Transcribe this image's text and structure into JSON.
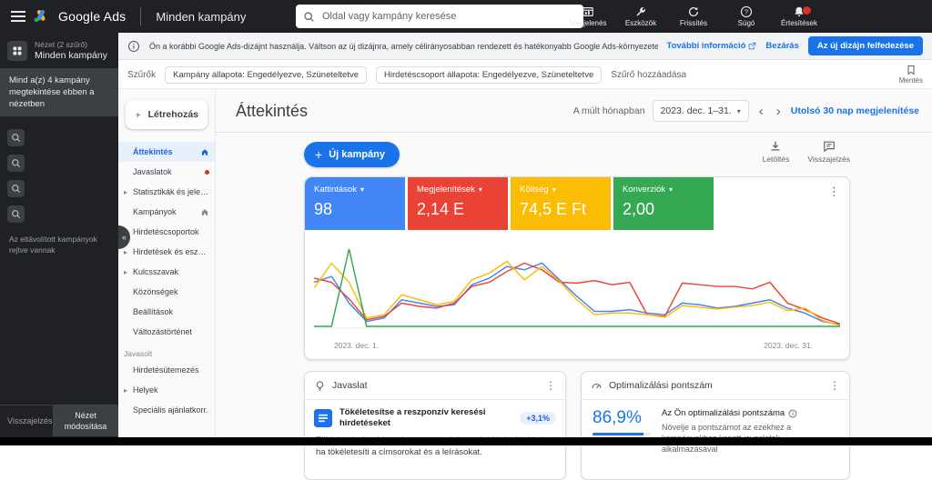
{
  "topbar": {
    "brand": "Google Ads",
    "page_title": "Minden kampány",
    "search_placeholder": "Oldal vagy kampány keresése",
    "actions": [
      {
        "label": "Megjelenés",
        "icon": "appearance-icon"
      },
      {
        "label": "Eszközök",
        "icon": "tools-icon"
      },
      {
        "label": "Frissítés",
        "icon": "refresh-icon"
      },
      {
        "label": "Súgó",
        "icon": "help-icon"
      },
      {
        "label": "Értesítések",
        "icon": "notifications-icon",
        "has_badge": true
      }
    ]
  },
  "sidebar": {
    "view_label": "Nézet (2 szűrő)",
    "view_name": "Minden kampány",
    "selected_note": "Mind a(z) 4 kampány megtekintése ebben a nézetben",
    "hidden_note": "Az eltávolított kampányok rejtve vannak",
    "feedback": "Visszajelzés",
    "modify_view": "Nézet módosítása"
  },
  "banner": {
    "text": "Ön a korábbi Google Ads-dizájnt használja. Váltson az új dizájnra, amely célirányosabban rendezett és hatékonyabb Google Ads-környezetet biztosít.",
    "learn_more": "További információ",
    "dismiss": "Bezárás",
    "cta": "Az új dizájn felfedezése"
  },
  "filters": {
    "label": "Szűrők",
    "chips": [
      "Kampány állapota: Engedélyezve, Szüneteltetve",
      "Hirdetéscsoport állapota: Engedélyezve, Szüneteltetve"
    ],
    "add": "Szűrő hozzáadása",
    "save": "Mentés"
  },
  "nav": {
    "create": "Létrehozás",
    "items": [
      {
        "label": "Áttekintés",
        "selected": true,
        "home": true
      },
      {
        "label": "Javaslatok",
        "dot": true
      },
      {
        "label": "Statisztikák és jelentések",
        "expandable": true
      },
      {
        "label": "Kampányok",
        "home": true
      },
      {
        "label": "Hirdetéscsoportok"
      },
      {
        "label": "Hirdetések és eszközök",
        "expandable": true
      },
      {
        "label": "Kulcsszavak",
        "expandable": true
      },
      {
        "label": "Közönségek"
      },
      {
        "label": "Beállítások"
      },
      {
        "label": "Változástörténet"
      },
      {
        "label": "Javasolt",
        "section": true
      },
      {
        "label": "Hirdetésütemezés"
      },
      {
        "label": "Helyek",
        "expandable": true
      },
      {
        "label": "Speciális ajánlatkorr."
      }
    ]
  },
  "main": {
    "title": "Áttekintés",
    "date_label": "A múlt hónapban",
    "date_range": "2023. dec. 1–31.",
    "show_last": "Utolsó 30 nap megjelenítése",
    "new_campaign": "Új kampány",
    "download": "Letöltés",
    "feedback": "Visszajelzés"
  },
  "metrics": [
    {
      "label": "Kattintások",
      "value": "98",
      "color": "#4285f4"
    },
    {
      "label": "Megjelenítések",
      "value": "2,14 E",
      "color": "#ea4335"
    },
    {
      "label": "Költség",
      "value": "74,5 E Ft",
      "color": "#fbbc04"
    },
    {
      "label": "Konverziók",
      "value": "2,00",
      "color": "#34a853"
    }
  ],
  "chart_data": {
    "type": "line",
    "x_start_label": "2023. dec. 1.",
    "x_end_label": "2023. dec. 31.",
    "x_range_days": 31,
    "ylim": [
      0,
      100
    ],
    "series": [
      {
        "name": "Kattintások",
        "color": "#4285f4",
        "values": [
          55,
          62,
          30,
          8,
          12,
          34,
          30,
          26,
          28,
          52,
          60,
          74,
          70,
          78,
          58,
          38,
          20,
          20,
          22,
          18,
          16,
          30,
          28,
          24,
          26,
          30,
          34,
          24,
          18,
          8,
          4
        ]
      },
      {
        "name": "Megjelenítések",
        "color": "#ea4335",
        "values": [
          60,
          55,
          35,
          10,
          14,
          30,
          26,
          24,
          30,
          50,
          55,
          68,
          78,
          70,
          55,
          54,
          57,
          52,
          55,
          16,
          14,
          54,
          52,
          50,
          50,
          47,
          55,
          30,
          22,
          12,
          5
        ]
      },
      {
        "name": "Költség",
        "color": "#fbbc04",
        "values": [
          48,
          78,
          55,
          12,
          16,
          40,
          34,
          28,
          32,
          58,
          66,
          80,
          58,
          74,
          56,
          34,
          16,
          18,
          18,
          16,
          13,
          27,
          25,
          23,
          25,
          27,
          31,
          21,
          24,
          9,
          3
        ]
      },
      {
        "name": "Konverziók",
        "color": "#34a853",
        "values": [
          2,
          2,
          95,
          2,
          2,
          2,
          2,
          2,
          2,
          2,
          2,
          2,
          2,
          2,
          2,
          2,
          2,
          2,
          2,
          2,
          2,
          2,
          2,
          2,
          2,
          2,
          2,
          2,
          2,
          2,
          2
        ]
      }
    ]
  },
  "suggestion_card": {
    "title": "Javaslat",
    "item_title": "Tökéletesítse a reszponzív keresési hirdetéseket",
    "badge": "+3,1%",
    "body": "Több kattintást érhet el a reszponzív keresési hirdetésekkel, ha tökéletesíti a címsorokat és a leírásokat."
  },
  "optiscore_card": {
    "title": "Optimalizálási pontszám",
    "score": "86,9%",
    "score_label": "Az Ön optimalizálási pontszáma",
    "body": "Növelje a pontszámot az ezekhez a kampányokhoz kapott javaslatok alkalmazásával",
    "progress_pct": 86.9
  }
}
